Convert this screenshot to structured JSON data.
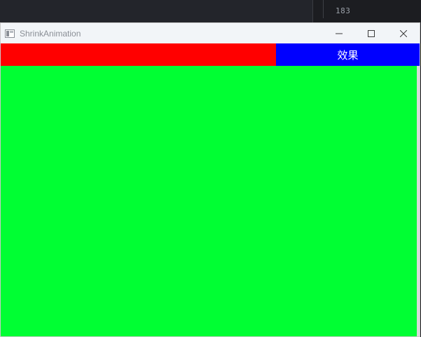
{
  "background": {
    "code_text": "183"
  },
  "window": {
    "title": "ShrinkAnimation",
    "controls": {
      "minimize": "minimize",
      "maximize": "maximize",
      "close": "close"
    }
  },
  "content": {
    "button_label": "效果"
  },
  "colors": {
    "red_panel": "#ff0000",
    "blue_button": "#0000ff",
    "green_area": "#00ff33"
  },
  "icons": {
    "app": "app-window-icon",
    "minimize": "minimize-icon",
    "maximize": "maximize-icon",
    "close": "close-icon"
  }
}
